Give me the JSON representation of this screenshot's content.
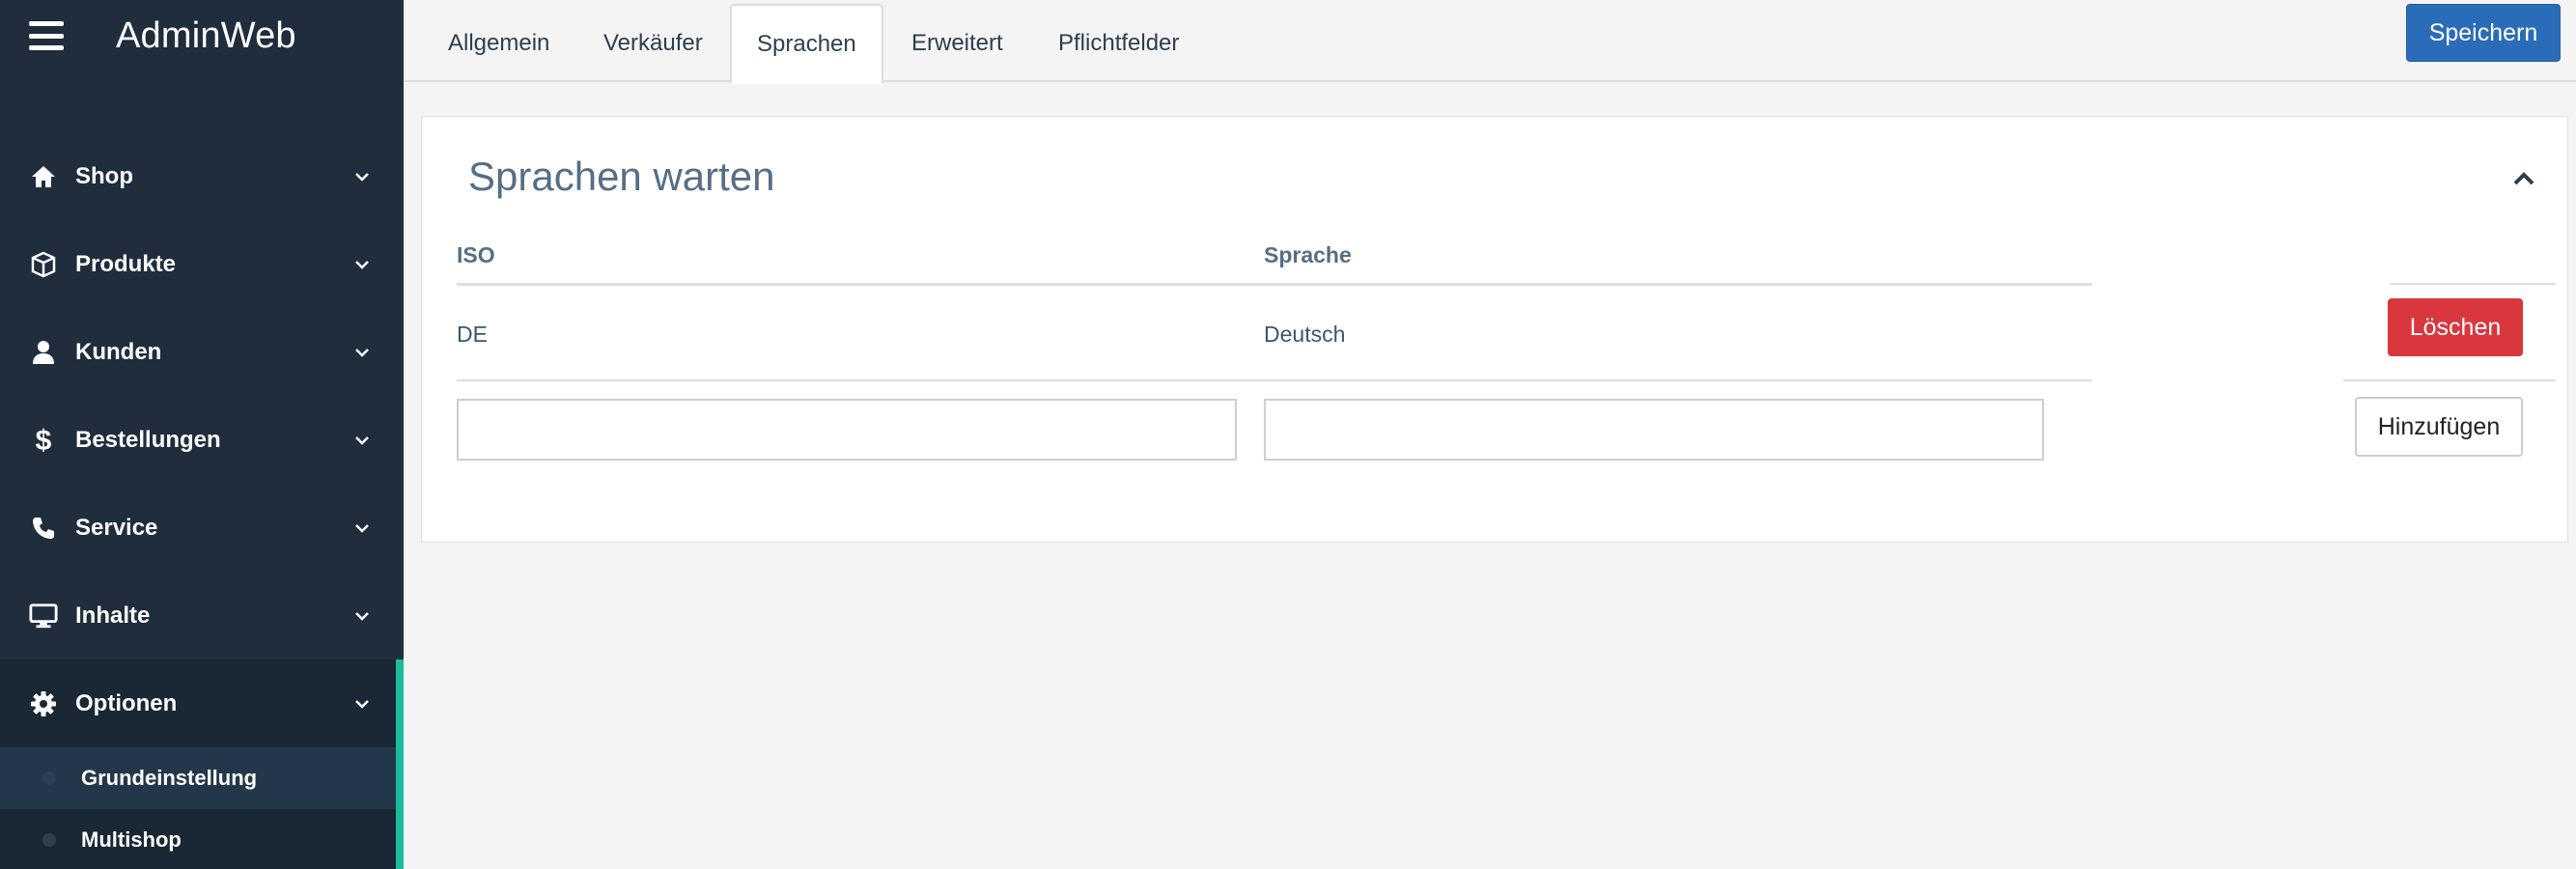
{
  "app": {
    "brand": "AdminWeb"
  },
  "sidebar": {
    "items": [
      {
        "label": "Shop",
        "icon": "home-icon"
      },
      {
        "label": "Produkte",
        "icon": "box-icon"
      },
      {
        "label": "Kunden",
        "icon": "user-icon"
      },
      {
        "label": "Bestellungen",
        "icon": "dollar-icon"
      },
      {
        "label": "Service",
        "icon": "phone-icon"
      },
      {
        "label": "Inhalte",
        "icon": "monitor-icon"
      },
      {
        "label": "Optionen",
        "icon": "gear-icon"
      }
    ],
    "subitems": [
      {
        "label": "Grundeinstellung"
      },
      {
        "label": "Multishop"
      }
    ]
  },
  "tabs": [
    {
      "label": "Allgemein"
    },
    {
      "label": "Verkäufer"
    },
    {
      "label": "Sprachen"
    },
    {
      "label": "Erweitert"
    },
    {
      "label": "Pflichtfelder"
    }
  ],
  "toolbar": {
    "save_label": "Speichern"
  },
  "panel": {
    "title": "Sprachen warten",
    "columns": [
      "ISO",
      "Sprache"
    ],
    "rows": [
      {
        "iso": "DE",
        "sprache": "Deutsch"
      }
    ],
    "delete_label": "Löschen",
    "add_label": "Hinzufügen",
    "new_iso_value": "",
    "new_sprache_value": ""
  },
  "colors": {
    "sidebar_bg": "#1f2d3d",
    "accent": "#1abc9c",
    "primary": "#2b6cb8",
    "danger": "#d9363e",
    "heading": "#566e86"
  }
}
